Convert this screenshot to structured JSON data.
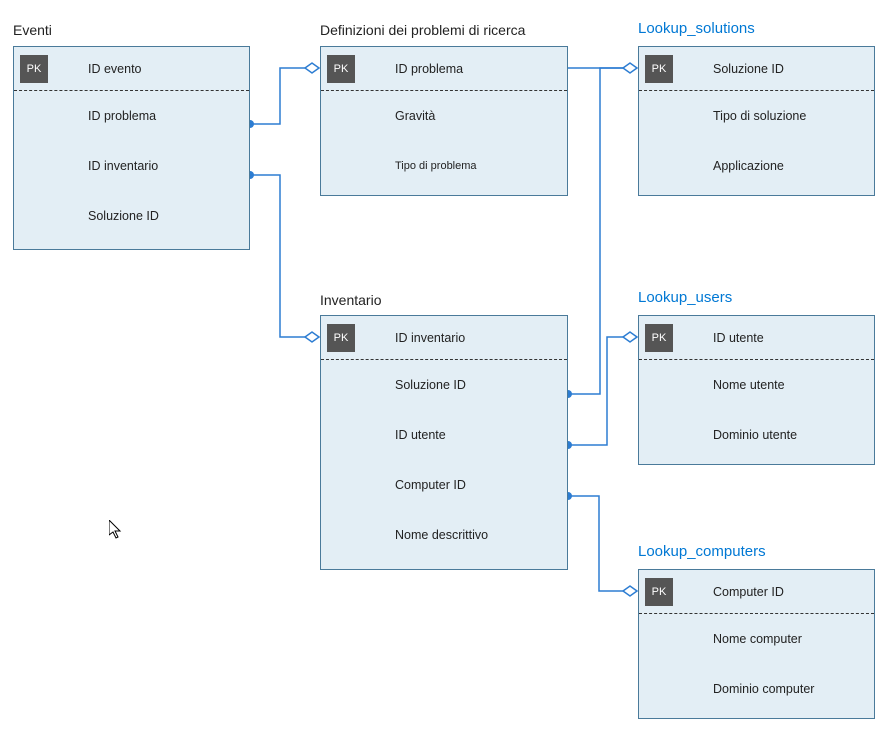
{
  "entities": {
    "eventi": {
      "title": "Eventi",
      "pk": "ID evento",
      "fields": [
        "ID problema",
        "ID inventario",
        "Soluzione  ID"
      ]
    },
    "problemi": {
      "title": "Definizioni dei problemi di ricerca",
      "pk": "ID problema",
      "fields": [
        "Gravità",
        "Tipo di problema"
      ]
    },
    "solutions": {
      "title": "Lookup_solutions",
      "pk": "Soluzione  ID",
      "fields": [
        "Tipo di soluzione",
        "Applicazione"
      ]
    },
    "inventario": {
      "title": "Inventario",
      "pk": "ID inventario",
      "fields": [
        "Soluzione  ID",
        "ID utente",
        "Computer ID",
        "Nome descrittivo"
      ]
    },
    "users": {
      "title": "Lookup_users",
      "pk": "ID utente",
      "fields": [
        "Nome utente",
        "Dominio utente"
      ]
    },
    "computers": {
      "title": "Lookup_computers",
      "pk": "Computer ID",
      "fields": [
        "Nome computer",
        "Dominio computer"
      ]
    }
  },
  "pk_label": "PK"
}
